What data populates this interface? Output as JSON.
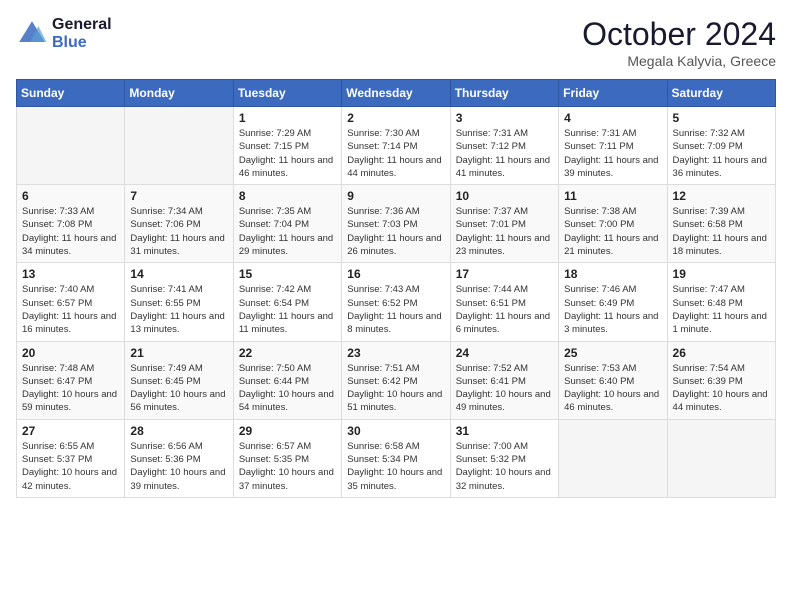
{
  "header": {
    "logo_line1": "General",
    "logo_line2": "Blue",
    "month": "October 2024",
    "location": "Megala Kalyvia, Greece"
  },
  "weekdays": [
    "Sunday",
    "Monday",
    "Tuesday",
    "Wednesday",
    "Thursday",
    "Friday",
    "Saturday"
  ],
  "weeks": [
    [
      {
        "day": null,
        "sunrise": null,
        "sunset": null,
        "daylight": null
      },
      {
        "day": null,
        "sunrise": null,
        "sunset": null,
        "daylight": null
      },
      {
        "day": "1",
        "sunrise": "Sunrise: 7:29 AM",
        "sunset": "Sunset: 7:15 PM",
        "daylight": "Daylight: 11 hours and 46 minutes."
      },
      {
        "day": "2",
        "sunrise": "Sunrise: 7:30 AM",
        "sunset": "Sunset: 7:14 PM",
        "daylight": "Daylight: 11 hours and 44 minutes."
      },
      {
        "day": "3",
        "sunrise": "Sunrise: 7:31 AM",
        "sunset": "Sunset: 7:12 PM",
        "daylight": "Daylight: 11 hours and 41 minutes."
      },
      {
        "day": "4",
        "sunrise": "Sunrise: 7:31 AM",
        "sunset": "Sunset: 7:11 PM",
        "daylight": "Daylight: 11 hours and 39 minutes."
      },
      {
        "day": "5",
        "sunrise": "Sunrise: 7:32 AM",
        "sunset": "Sunset: 7:09 PM",
        "daylight": "Daylight: 11 hours and 36 minutes."
      }
    ],
    [
      {
        "day": "6",
        "sunrise": "Sunrise: 7:33 AM",
        "sunset": "Sunset: 7:08 PM",
        "daylight": "Daylight: 11 hours and 34 minutes."
      },
      {
        "day": "7",
        "sunrise": "Sunrise: 7:34 AM",
        "sunset": "Sunset: 7:06 PM",
        "daylight": "Daylight: 11 hours and 31 minutes."
      },
      {
        "day": "8",
        "sunrise": "Sunrise: 7:35 AM",
        "sunset": "Sunset: 7:04 PM",
        "daylight": "Daylight: 11 hours and 29 minutes."
      },
      {
        "day": "9",
        "sunrise": "Sunrise: 7:36 AM",
        "sunset": "Sunset: 7:03 PM",
        "daylight": "Daylight: 11 hours and 26 minutes."
      },
      {
        "day": "10",
        "sunrise": "Sunrise: 7:37 AM",
        "sunset": "Sunset: 7:01 PM",
        "daylight": "Daylight: 11 hours and 23 minutes."
      },
      {
        "day": "11",
        "sunrise": "Sunrise: 7:38 AM",
        "sunset": "Sunset: 7:00 PM",
        "daylight": "Daylight: 11 hours and 21 minutes."
      },
      {
        "day": "12",
        "sunrise": "Sunrise: 7:39 AM",
        "sunset": "Sunset: 6:58 PM",
        "daylight": "Daylight: 11 hours and 18 minutes."
      }
    ],
    [
      {
        "day": "13",
        "sunrise": "Sunrise: 7:40 AM",
        "sunset": "Sunset: 6:57 PM",
        "daylight": "Daylight: 11 hours and 16 minutes."
      },
      {
        "day": "14",
        "sunrise": "Sunrise: 7:41 AM",
        "sunset": "Sunset: 6:55 PM",
        "daylight": "Daylight: 11 hours and 13 minutes."
      },
      {
        "day": "15",
        "sunrise": "Sunrise: 7:42 AM",
        "sunset": "Sunset: 6:54 PM",
        "daylight": "Daylight: 11 hours and 11 minutes."
      },
      {
        "day": "16",
        "sunrise": "Sunrise: 7:43 AM",
        "sunset": "Sunset: 6:52 PM",
        "daylight": "Daylight: 11 hours and 8 minutes."
      },
      {
        "day": "17",
        "sunrise": "Sunrise: 7:44 AM",
        "sunset": "Sunset: 6:51 PM",
        "daylight": "Daylight: 11 hours and 6 minutes."
      },
      {
        "day": "18",
        "sunrise": "Sunrise: 7:46 AM",
        "sunset": "Sunset: 6:49 PM",
        "daylight": "Daylight: 11 hours and 3 minutes."
      },
      {
        "day": "19",
        "sunrise": "Sunrise: 7:47 AM",
        "sunset": "Sunset: 6:48 PM",
        "daylight": "Daylight: 11 hours and 1 minute."
      }
    ],
    [
      {
        "day": "20",
        "sunrise": "Sunrise: 7:48 AM",
        "sunset": "Sunset: 6:47 PM",
        "daylight": "Daylight: 10 hours and 59 minutes."
      },
      {
        "day": "21",
        "sunrise": "Sunrise: 7:49 AM",
        "sunset": "Sunset: 6:45 PM",
        "daylight": "Daylight: 10 hours and 56 minutes."
      },
      {
        "day": "22",
        "sunrise": "Sunrise: 7:50 AM",
        "sunset": "Sunset: 6:44 PM",
        "daylight": "Daylight: 10 hours and 54 minutes."
      },
      {
        "day": "23",
        "sunrise": "Sunrise: 7:51 AM",
        "sunset": "Sunset: 6:42 PM",
        "daylight": "Daylight: 10 hours and 51 minutes."
      },
      {
        "day": "24",
        "sunrise": "Sunrise: 7:52 AM",
        "sunset": "Sunset: 6:41 PM",
        "daylight": "Daylight: 10 hours and 49 minutes."
      },
      {
        "day": "25",
        "sunrise": "Sunrise: 7:53 AM",
        "sunset": "Sunset: 6:40 PM",
        "daylight": "Daylight: 10 hours and 46 minutes."
      },
      {
        "day": "26",
        "sunrise": "Sunrise: 7:54 AM",
        "sunset": "Sunset: 6:39 PM",
        "daylight": "Daylight: 10 hours and 44 minutes."
      }
    ],
    [
      {
        "day": "27",
        "sunrise": "Sunrise: 6:55 AM",
        "sunset": "Sunset: 5:37 PM",
        "daylight": "Daylight: 10 hours and 42 minutes."
      },
      {
        "day": "28",
        "sunrise": "Sunrise: 6:56 AM",
        "sunset": "Sunset: 5:36 PM",
        "daylight": "Daylight: 10 hours and 39 minutes."
      },
      {
        "day": "29",
        "sunrise": "Sunrise: 6:57 AM",
        "sunset": "Sunset: 5:35 PM",
        "daylight": "Daylight: 10 hours and 37 minutes."
      },
      {
        "day": "30",
        "sunrise": "Sunrise: 6:58 AM",
        "sunset": "Sunset: 5:34 PM",
        "daylight": "Daylight: 10 hours and 35 minutes."
      },
      {
        "day": "31",
        "sunrise": "Sunrise: 7:00 AM",
        "sunset": "Sunset: 5:32 PM",
        "daylight": "Daylight: 10 hours and 32 minutes."
      },
      {
        "day": null,
        "sunrise": null,
        "sunset": null,
        "daylight": null
      },
      {
        "day": null,
        "sunrise": null,
        "sunset": null,
        "daylight": null
      }
    ]
  ]
}
